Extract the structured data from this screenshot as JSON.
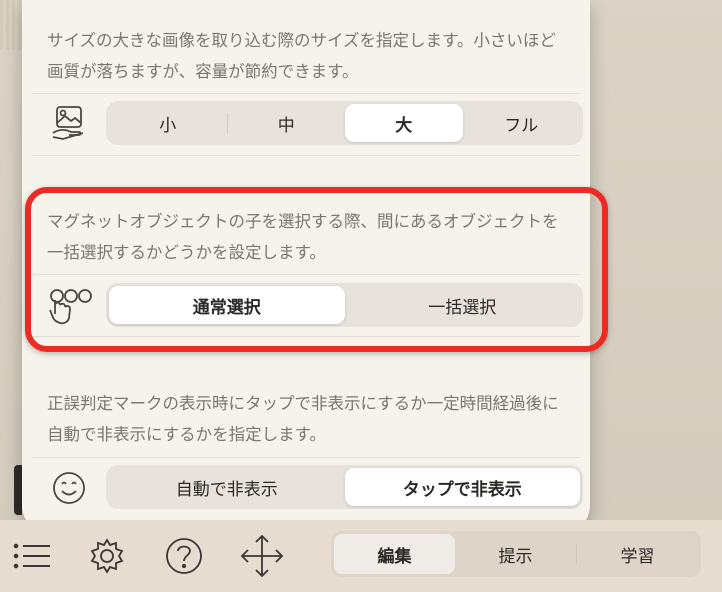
{
  "sections": [
    {
      "description": "サイズの大きな画像を取り込む際のサイズを指定します。小さいほど画質が落ちますが、容量が節約できます。",
      "icon": "image-hand-icon",
      "options": [
        "小",
        "中",
        "大",
        "フル"
      ],
      "selected": 2
    },
    {
      "description": "マグネットオブジェクトの子を選択する際、間にあるオブジェクトを一括選択するかどうかを設定します。",
      "icon": "tap-circles-icon",
      "options": [
        "通常選択",
        "一括選択"
      ],
      "selected": 0
    },
    {
      "description": "正誤判定マークの表示時にタップで非表示にするか一定時間経過後に自動で非表示にするかを指定します。",
      "icon": "smiley-icon",
      "options": [
        "自動で非表示",
        "タップで非表示"
      ],
      "selected": 1
    }
  ],
  "toolbar": {
    "icons": [
      "menu-icon",
      "settings-gear-icon",
      "help-icon",
      "move-arrows-icon"
    ],
    "modes": [
      "編集",
      "提示",
      "学習"
    ],
    "selected_mode": 0
  },
  "colors": {
    "highlight": "#ec2a26",
    "popover_bg": "#f6f2ec",
    "segment_bg": "#e7e2dc"
  }
}
